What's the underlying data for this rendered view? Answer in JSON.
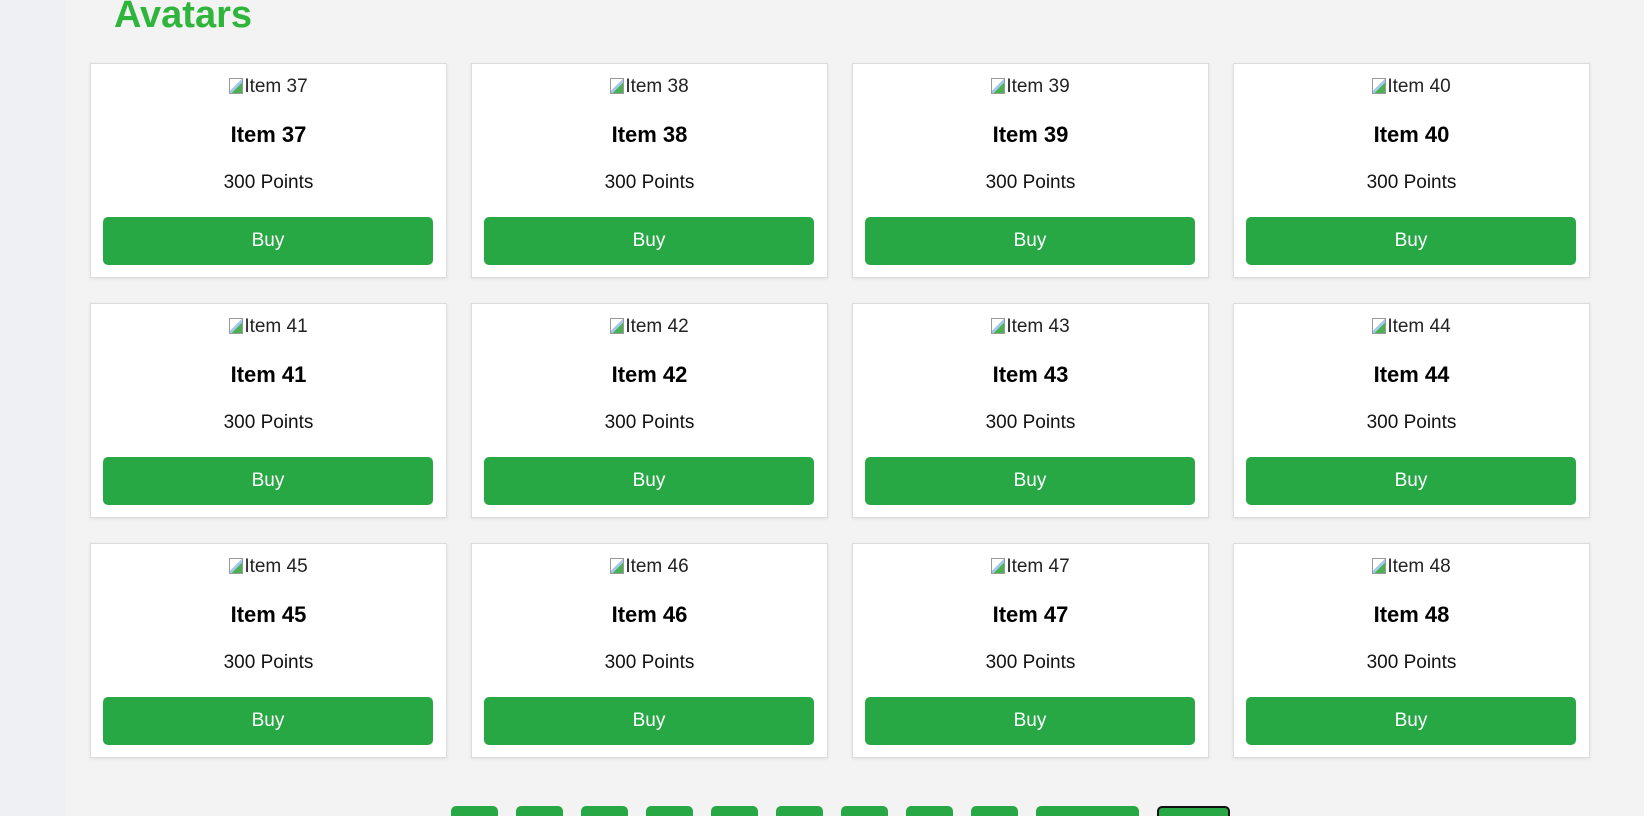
{
  "section": {
    "title": "Avatars"
  },
  "colors": {
    "accent": "#28a745",
    "title": "#30b53c",
    "background": "#f3f3f3"
  },
  "items": [
    {
      "img_alt": "Item 37",
      "name": "Item 37",
      "price": "300 Points",
      "button": "Buy"
    },
    {
      "img_alt": "Item 38",
      "name": "Item 38",
      "price": "300 Points",
      "button": "Buy"
    },
    {
      "img_alt": "Item 39",
      "name": "Item 39",
      "price": "300 Points",
      "button": "Buy"
    },
    {
      "img_alt": "Item 40",
      "name": "Item 40",
      "price": "300 Points",
      "button": "Buy"
    },
    {
      "img_alt": "Item 41",
      "name": "Item 41",
      "price": "300 Points",
      "button": "Buy"
    },
    {
      "img_alt": "Item 42",
      "name": "Item 42",
      "price": "300 Points",
      "button": "Buy"
    },
    {
      "img_alt": "Item 43",
      "name": "Item 43",
      "price": "300 Points",
      "button": "Buy"
    },
    {
      "img_alt": "Item 44",
      "name": "Item 44",
      "price": "300 Points",
      "button": "Buy"
    },
    {
      "img_alt": "Item 45",
      "name": "Item 45",
      "price": "300 Points",
      "button": "Buy"
    },
    {
      "img_alt": "Item 46",
      "name": "Item 46",
      "price": "300 Points",
      "button": "Buy"
    },
    {
      "img_alt": "Item 47",
      "name": "Item 47",
      "price": "300 Points",
      "button": "Buy"
    },
    {
      "img_alt": "Item 48",
      "name": "Item 48",
      "price": "300 Points",
      "button": "Buy"
    }
  ]
}
